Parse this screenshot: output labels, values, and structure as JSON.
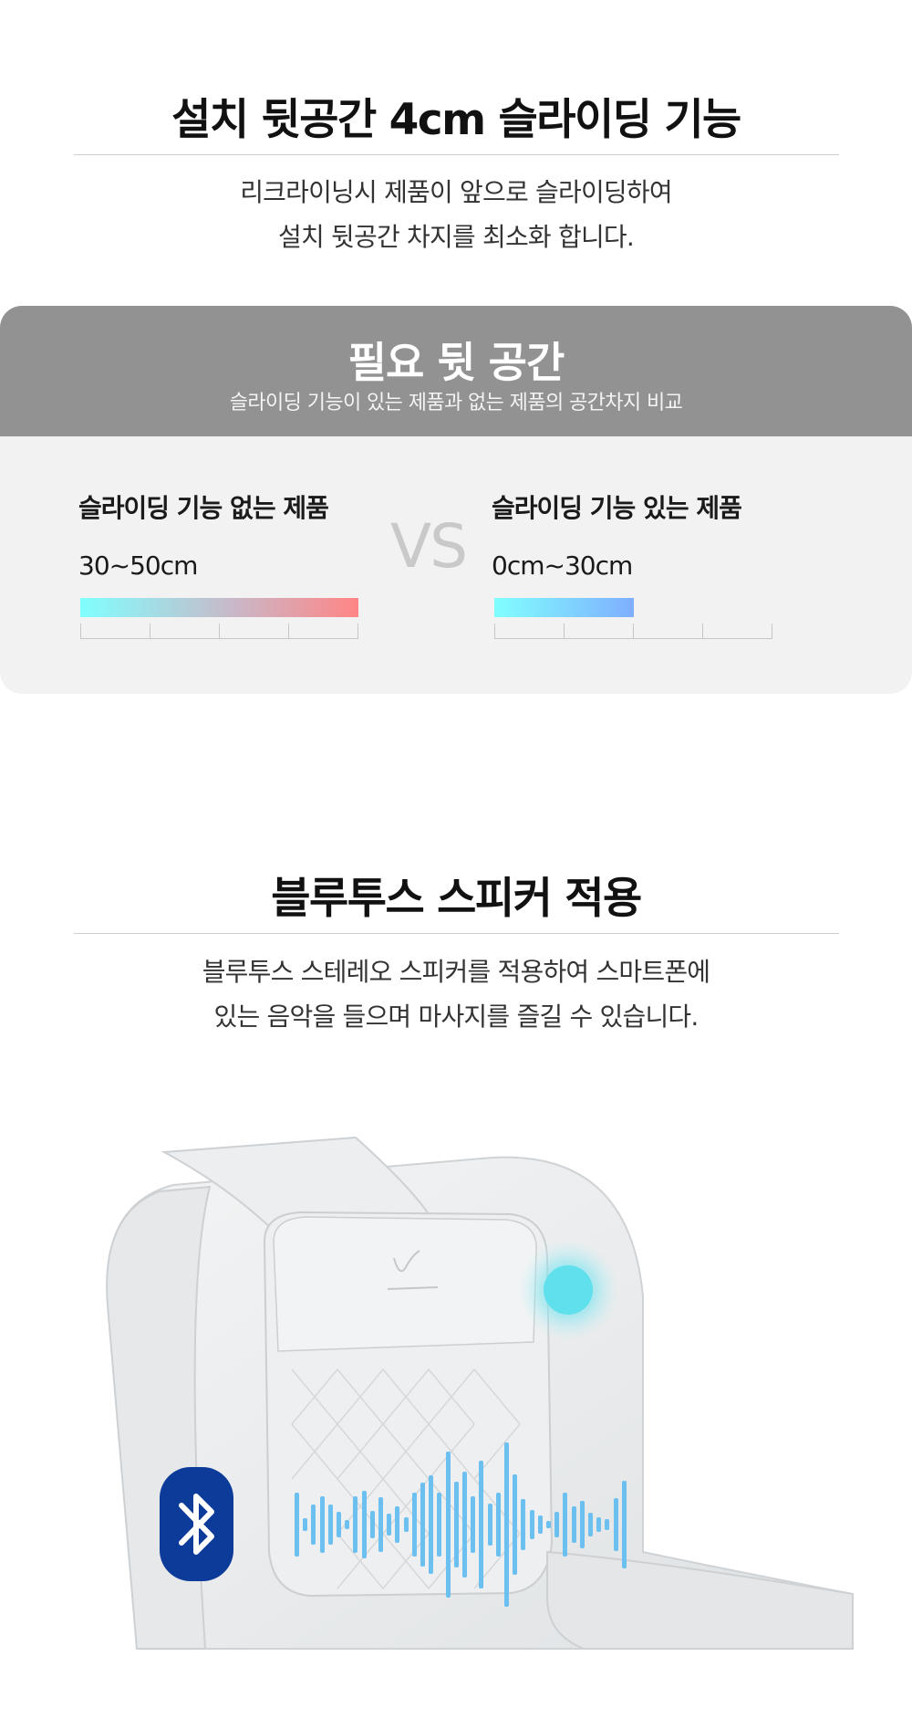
{
  "sliding": {
    "title": "설치 뒷공간 4cm 슬라이딩 기능",
    "desc_lines": [
      "리크라이닝시 제품이 앞으로 슬라이딩하여",
      "설치 뒷공간 차지를 최소화 합니다."
    ]
  },
  "comparison": {
    "title": "필요 뒷 공간",
    "subtitle": "슬라이딩 기능이 있는 제품과 없는 제품의 공간차지 비교",
    "vs_label": "VS",
    "without": {
      "label": "슬라이딩 기능 없는 제품",
      "range": "30~50cm",
      "fill_fraction": 1.0
    },
    "with": {
      "label": "슬라이딩 기능 있는 제품",
      "range": "0cm~30cm",
      "fill_fraction": 0.5
    },
    "colors": {
      "without_start": "#80ffff",
      "without_end": "#ff8585",
      "with_start": "#80ffff",
      "with_end": "#7faeff"
    }
  },
  "bluetooth": {
    "title": "블루투스 스피커 적용",
    "desc_lines": [
      "블루투스 스테레오 스피커를 적용하여 스마트폰에",
      "있는 음악을 들으며 마사지를 즐길 수 있습니다."
    ],
    "brand_color": "#0d3b9a",
    "wave_color": "#6cc0ef"
  },
  "icons": {
    "bluetooth": "bluetooth-icon",
    "speaker": "speaker-glow-icon",
    "chair": "massage-chair-image",
    "logo": "chair-logo"
  }
}
